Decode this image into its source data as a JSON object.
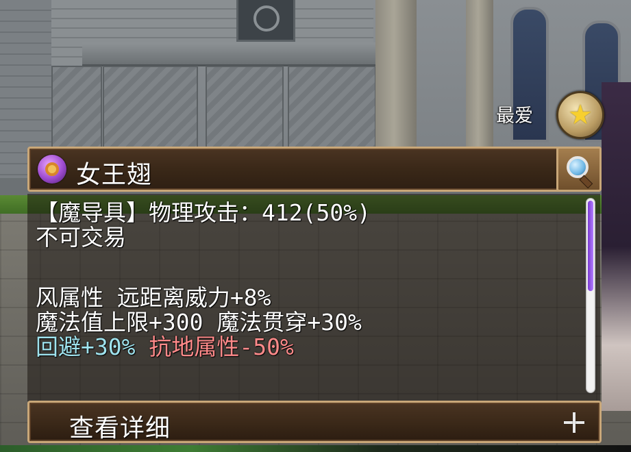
{
  "favorite": {
    "label": "最爱",
    "icon": "star-icon"
  },
  "item": {
    "name": "女王翅",
    "icon": "item-ring-icon",
    "inspect_icon": "magnifier-icon"
  },
  "description": {
    "type_line": "【魔导具】物理攻击：412(50%)",
    "trade_status": "不可交易",
    "attribute_line": "风属性  远距离威力+8%",
    "bonus_line": "魔法值上限+300  魔法贯穿+30%",
    "dodge_text": "回避+30%",
    "resist_text": "抗地属性-50%"
  },
  "colors": {
    "dodge": "#9fe3ee",
    "resist": "#ff8a8a",
    "scroll_thumb": "#9b5cf0"
  },
  "details": {
    "label": "查看详细",
    "icon": "plus-icon"
  }
}
